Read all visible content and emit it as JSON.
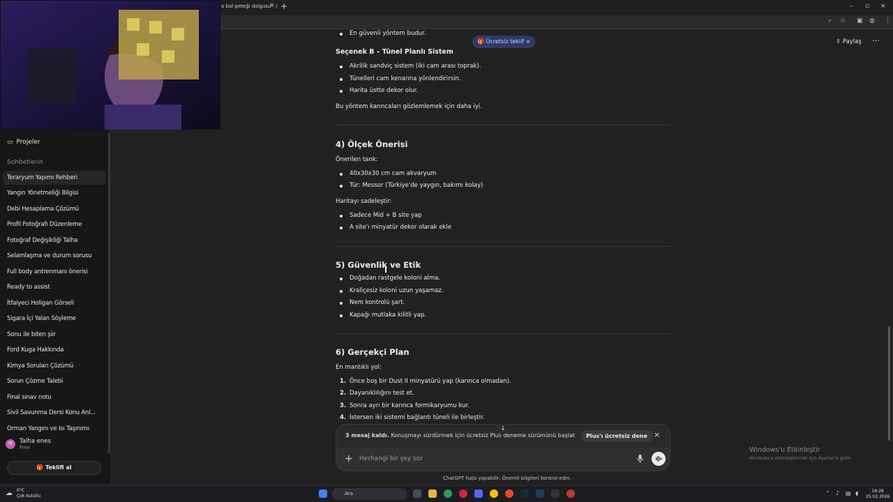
{
  "browser": {
    "tab_title": "o bal peteği dolgusu - (",
    "tab_close": "×",
    "new_tab": "+",
    "window_controls": [
      "–",
      "▫",
      "×"
    ]
  },
  "sidebar": {
    "projects_label": "Projeler",
    "section_label": "Sohbetlerin",
    "chats": [
      "Teraryum Yapımı Rehberi",
      "Yangın Yönetmeliği Bilgisi",
      "Debi Hesaplama Çözümü",
      "Profil Fotoğrafı Düzenleme",
      "Fotoğraf Değişikliği Talha",
      "Selamlaşma ve durum sorusu",
      "Full body antrenmanı önerisi",
      "Ready to assist",
      "İtfaiyeci Holigan Görseli",
      "Sigara İçi Yalan Söyleme",
      "Sonu ile biten şiir",
      "Ford Kuga Hakkında",
      "Kimya Soruları Çözümü",
      "Sorun Çözme Talebi",
      "Final sınav notu",
      "Sivil Savunma Dersi Konu Anl...",
      "Orman Yangını ve Isı Taşınımı"
    ],
    "user": {
      "initials": "TE",
      "name": "Talha enes",
      "plan": "Free"
    },
    "offer_button": "Teklifi al"
  },
  "header": {
    "offer_pill": "Ücretsiz teklif",
    "offer_close": "×",
    "share": "Paylaş",
    "more": "···"
  },
  "content": {
    "top_bullet": "En güvenli yöntem budur.",
    "option_b_title": "Seçenek B – Tünel Planlı Sistem",
    "option_b_bullets": [
      "Akrilik sandviç sistem (iki cam arası toprak).",
      "Tünelleri cam kenarına yönlendirirsin.",
      "Harita üstte dekor olur."
    ],
    "option_b_note": "Bu yöntem karıncaları gözlemlemek için daha iyi.",
    "s4_title": "4) Ölçek Önerisi",
    "s4_intro": "Önerilen tank:",
    "s4_bullets": [
      "40x30x30 cm cam akvaryum",
      "Tür: Messor (Türkiye'de yaygın, bakımı kolay)"
    ],
    "s4_sub": "Haritayı sadeleştir:",
    "s4_bullets2": [
      "Sadece Mid + B site yap",
      "A site'ı minyatür dekor olarak ekle"
    ],
    "s5_title": "5) Güvenlik ve Etik",
    "s5_bullets": [
      "Doğadan rastgele koloni alma.",
      "Kraliçesiz koloni uzun yaşamaz.",
      "Nem kontrolü şart.",
      "Kapağı mutlaka kilitli yap."
    ],
    "s6_title": "6) Gerçekçi Plan",
    "s6_intro": "En mantıklı yol:",
    "s6_steps": [
      "Önce boş bir Dust II minyatürü yap (karınca olmadan).",
      "Dayanıklılığını test et.",
      "Sonra ayrı bir karınca formikaryumu kur.",
      "İstersen iki sistemi bağlantı tüneli ile birleştir."
    ],
    "s6_numbers": [
      "1.",
      "2.",
      "3.",
      "4."
    ]
  },
  "limit_bar": {
    "bold": "3 mesaj kaldı.",
    "text": " Konuşmayı sürdürmek için ücretsiz Plus deneme sürümünü başlat",
    "button": "Plus'ı ücretsiz dene",
    "close": "×"
  },
  "composer": {
    "placeholder": "Herhangi bir şey sor",
    "plus": "+"
  },
  "footer_note": "ChatGPT hata yapabilir. Önemli bilgileri kontrol edin.",
  "watermark": {
    "line1": "Windows'u Etkinleştir",
    "line2": "Windows'u etkinleştirmek için Ayarlar'a gidin."
  },
  "taskbar": {
    "weather_temp": "0°C",
    "weather_desc": "Çok bulutlu",
    "search_label": "Ara",
    "time": "18:26",
    "date": "25.02.2026"
  }
}
